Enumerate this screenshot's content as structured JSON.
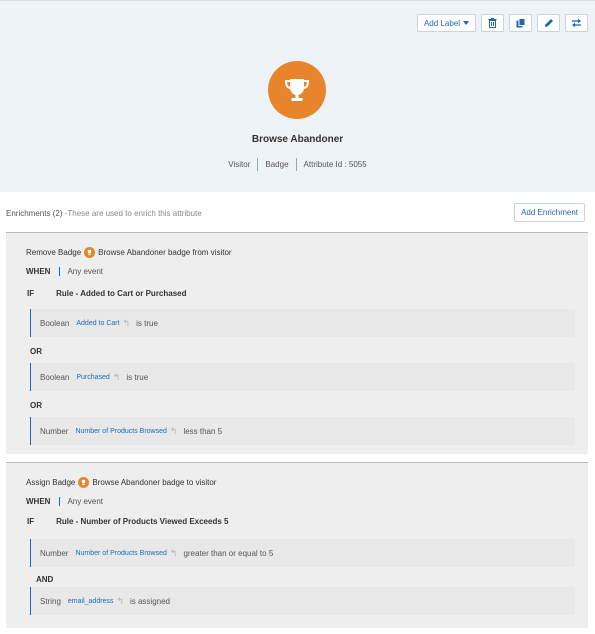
{
  "header": {
    "toolbar": {
      "add_label": "Add Label",
      "icons": [
        "trash-icon",
        "copy-icon",
        "pencil-icon",
        "swap-icon"
      ]
    },
    "badge_icon": "trophy-icon",
    "badge_color": "#e8852a",
    "title": "Browse Abandoner",
    "meta": {
      "type": "Visitor",
      "kind": "Badge",
      "attribute_id": "Attribute Id : 5055"
    }
  },
  "enrichments": {
    "heading": "Enrichments (2)",
    "description": "-These are used to enrich this attribute",
    "add_button": "Add Enrichment"
  },
  "panels": [
    {
      "action_verb": "Remove Badge",
      "action_rest": "Browse Abandoner badge from visitor",
      "when_label": "WHEN",
      "when_value": "Any event",
      "if_label": "IF",
      "rule_name": "Rule - Added to Cart or Purchased",
      "conditions": [
        {
          "type": "Boolean",
          "field": "Added to Cart",
          "operator": "is true"
        },
        {
          "type": "Boolean",
          "field": "Purchased",
          "operator": "is true"
        },
        {
          "type": "Number",
          "field": "Number of Products Browsed",
          "operator": "less than 5"
        }
      ],
      "connectors": [
        "OR",
        "OR"
      ]
    },
    {
      "action_verb": "Assign Badge",
      "action_rest": "Browse Abandoner badge to visitor",
      "when_label": "WHEN",
      "when_value": "Any event",
      "if_label": "IF",
      "rule_name": "Rule - Number of Products Viewed Exceeds 5",
      "conditions": [
        {
          "type": "Number",
          "field": "Number of Products Browsed",
          "operator": "greater than or equal to 5"
        },
        {
          "type": "String",
          "field": "email_address",
          "operator": "is assigned"
        }
      ],
      "connectors": [
        "AND"
      ]
    }
  ],
  "colors": {
    "accent": "#1f69b3",
    "badge": "#e8852a",
    "header_bg": "#eef3f8",
    "panel_bg": "#eeeeee"
  }
}
